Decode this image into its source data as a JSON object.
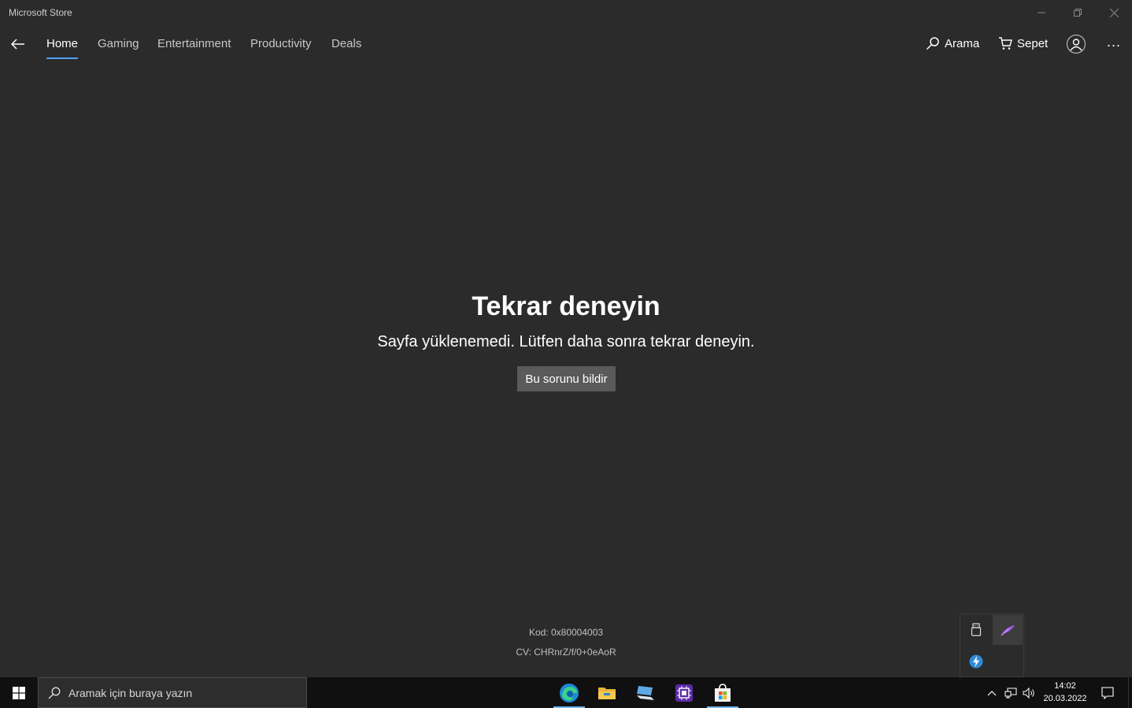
{
  "window": {
    "title": "Microsoft Store"
  },
  "nav": {
    "tabs": [
      {
        "label": "Home",
        "active": true
      },
      {
        "label": "Gaming",
        "active": false
      },
      {
        "label": "Entertainment",
        "active": false
      },
      {
        "label": "Productivity",
        "active": false
      },
      {
        "label": "Deals",
        "active": false
      }
    ],
    "search_label": "Arama",
    "cart_label": "Sepet",
    "more_label": "..."
  },
  "error": {
    "title": "Tekrar deneyin",
    "message": "Sayfa yüklenemedi. Lütfen daha sonra tekrar deneyin.",
    "report_button": "Bu sorunu bildir",
    "code": "Kod: 0x80004003",
    "cv": "CV: CHRnrZ/f/0+0eAoR"
  },
  "taskbar": {
    "search_placeholder": "Aramak için buraya yazın",
    "apps": [
      {
        "icon": "edge-icon",
        "running": true
      },
      {
        "icon": "file-explorer-icon",
        "running": false
      },
      {
        "icon": "remote-desktop-icon",
        "running": false
      },
      {
        "icon": "cpu-chip-app-icon",
        "running": false
      },
      {
        "icon": "microsoft-store-icon",
        "running": true
      }
    ],
    "time": "14:02",
    "date": "20.03.2022"
  },
  "tray_popup": {
    "icons": [
      "usb-device-icon",
      "feather-app-icon",
      "lightning-app-icon"
    ]
  },
  "colors": {
    "background": "#2b2b2b",
    "accent": "#4aa3ff",
    "taskbar": "#101010",
    "button": "#5a5a5a"
  }
}
